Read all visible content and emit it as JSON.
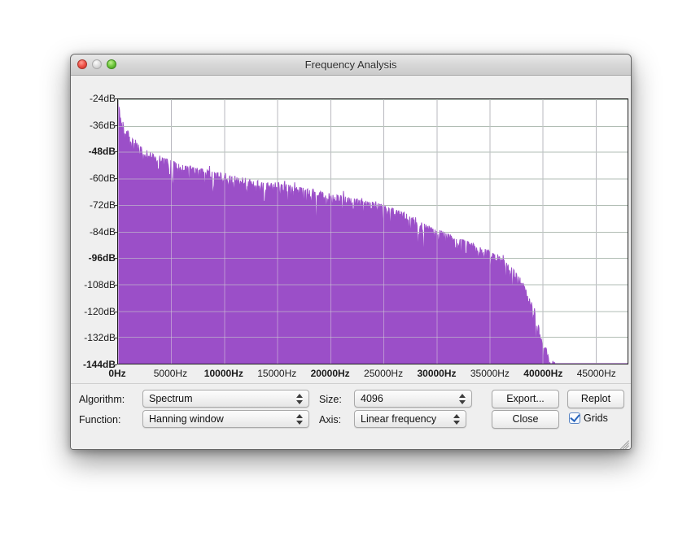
{
  "window": {
    "title": "Frequency Analysis",
    "traffic_lights": [
      "close-button",
      "minimize-button",
      "zoom-button"
    ],
    "resize_grip": "resize-grip"
  },
  "chart_data": {
    "type": "area",
    "title": "Frequency Analysis",
    "xlabel": "",
    "ylabel": "",
    "grid": true,
    "legend": null,
    "xlim": [
      0,
      48000
    ],
    "ylim": [
      -144,
      -24
    ],
    "x_unit": "Hz",
    "y_unit": "dB",
    "x_ticks": [
      0,
      5000,
      10000,
      15000,
      20000,
      25000,
      30000,
      35000,
      40000,
      45000
    ],
    "x_tick_labels": [
      "0Hz",
      "5000Hz",
      "10000Hz",
      "15000Hz",
      "20000Hz",
      "25000Hz",
      "30000Hz",
      "35000Hz",
      "40000Hz",
      "45000Hz"
    ],
    "x_tick_major": [
      true,
      false,
      true,
      false,
      true,
      false,
      true,
      false,
      true,
      false
    ],
    "y_ticks": [
      -24,
      -36,
      -48,
      -60,
      -72,
      -84,
      -96,
      -108,
      -120,
      -132,
      -144
    ],
    "y_tick_labels": [
      "-24dB",
      "-36dB",
      "-48dB",
      "-60dB",
      "-72dB",
      "-84dB",
      "-96dB",
      "-108dB",
      "-120dB",
      "-132dB",
      "-144dB"
    ],
    "y_tick_major": [
      false,
      false,
      true,
      false,
      false,
      false,
      true,
      false,
      false,
      false,
      true
    ],
    "series": [
      {
        "name": "Spectrum",
        "fill_color": "#9b4fc8",
        "x": [
          0,
          250,
          500,
          750,
          1000,
          1500,
          2000,
          2500,
          3000,
          3500,
          4000,
          5000,
          6000,
          7000,
          8000,
          9000,
          10000,
          11000,
          12000,
          13000,
          14000,
          15000,
          16000,
          17000,
          18000,
          19000,
          20000,
          21000,
          22000,
          23000,
          24000,
          25000,
          26000,
          27000,
          28000,
          29000,
          30000,
          31000,
          32000,
          33000,
          34000,
          35000,
          36000,
          37000,
          38000,
          39000,
          39500,
          40000,
          40500,
          41000,
          41500,
          42000,
          48000
        ],
        "values": [
          -24,
          -30,
          -34,
          -37,
          -39,
          -42,
          -44,
          -46,
          -47,
          -48,
          -49,
          -51,
          -53,
          -54,
          -55,
          -56,
          -57,
          -58,
          -59,
          -60,
          -61,
          -61,
          -62,
          -63,
          -64,
          -65,
          -66,
          -67,
          -68,
          -69,
          -70,
          -71,
          -73,
          -75,
          -78,
          -80,
          -82,
          -84,
          -86,
          -88,
          -90,
          -92,
          -95,
          -99,
          -105,
          -116,
          -124,
          -132,
          -138,
          -142,
          -144,
          -144,
          -144
        ]
      }
    ],
    "description": "Audio spectrum magnitude falling from about -24dB at 0Hz, decaying with noise spikes to roughly -80dB near 30000Hz, then rolling off steeply to the -144dB floor just past 40000Hz."
  },
  "controls": {
    "algorithm_label": "Algorithm:",
    "algorithm_value": "Spectrum",
    "function_label": "Function:",
    "function_value": "Hanning window",
    "size_label": "Size:",
    "size_value": "4096",
    "axis_label": "Axis:",
    "axis_value": "Linear frequency",
    "export_button": "Export...",
    "replot_button": "Replot",
    "close_button": "Close",
    "grids_label": "Grids",
    "grids_checked": true
  },
  "colors": {
    "spectrum": "#9b4fc8",
    "plot_bg": "#ffffff",
    "grid": "#8f9b93",
    "window_bg": "#efefef",
    "checkbox_accent": "#2a66bd"
  }
}
